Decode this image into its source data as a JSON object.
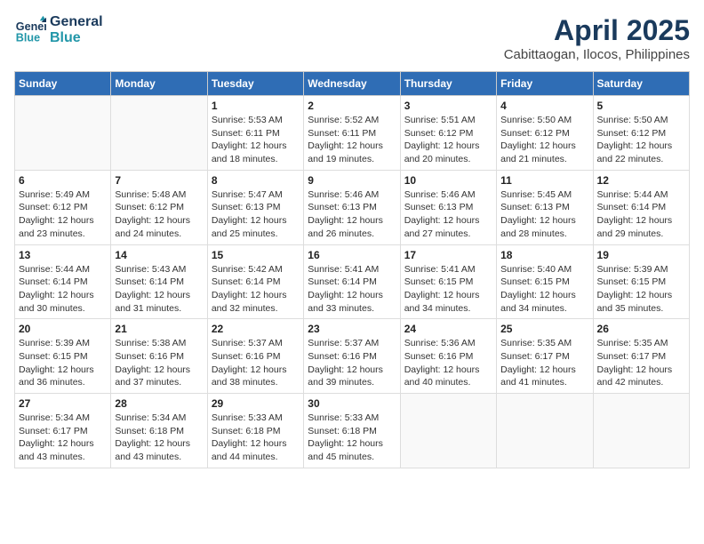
{
  "header": {
    "logo_line1": "General",
    "logo_line2": "Blue",
    "title": "April 2025",
    "subtitle": "Cabittaogan, Ilocos, Philippines"
  },
  "calendar": {
    "days_of_week": [
      "Sunday",
      "Monday",
      "Tuesday",
      "Wednesday",
      "Thursday",
      "Friday",
      "Saturday"
    ],
    "weeks": [
      [
        {
          "day": "",
          "info": ""
        },
        {
          "day": "",
          "info": ""
        },
        {
          "day": "1",
          "info": "Sunrise: 5:53 AM\nSunset: 6:11 PM\nDaylight: 12 hours and 18 minutes."
        },
        {
          "day": "2",
          "info": "Sunrise: 5:52 AM\nSunset: 6:11 PM\nDaylight: 12 hours and 19 minutes."
        },
        {
          "day": "3",
          "info": "Sunrise: 5:51 AM\nSunset: 6:12 PM\nDaylight: 12 hours and 20 minutes."
        },
        {
          "day": "4",
          "info": "Sunrise: 5:50 AM\nSunset: 6:12 PM\nDaylight: 12 hours and 21 minutes."
        },
        {
          "day": "5",
          "info": "Sunrise: 5:50 AM\nSunset: 6:12 PM\nDaylight: 12 hours and 22 minutes."
        }
      ],
      [
        {
          "day": "6",
          "info": "Sunrise: 5:49 AM\nSunset: 6:12 PM\nDaylight: 12 hours and 23 minutes."
        },
        {
          "day": "7",
          "info": "Sunrise: 5:48 AM\nSunset: 6:12 PM\nDaylight: 12 hours and 24 minutes."
        },
        {
          "day": "8",
          "info": "Sunrise: 5:47 AM\nSunset: 6:13 PM\nDaylight: 12 hours and 25 minutes."
        },
        {
          "day": "9",
          "info": "Sunrise: 5:46 AM\nSunset: 6:13 PM\nDaylight: 12 hours and 26 minutes."
        },
        {
          "day": "10",
          "info": "Sunrise: 5:46 AM\nSunset: 6:13 PM\nDaylight: 12 hours and 27 minutes."
        },
        {
          "day": "11",
          "info": "Sunrise: 5:45 AM\nSunset: 6:13 PM\nDaylight: 12 hours and 28 minutes."
        },
        {
          "day": "12",
          "info": "Sunrise: 5:44 AM\nSunset: 6:14 PM\nDaylight: 12 hours and 29 minutes."
        }
      ],
      [
        {
          "day": "13",
          "info": "Sunrise: 5:44 AM\nSunset: 6:14 PM\nDaylight: 12 hours and 30 minutes."
        },
        {
          "day": "14",
          "info": "Sunrise: 5:43 AM\nSunset: 6:14 PM\nDaylight: 12 hours and 31 minutes."
        },
        {
          "day": "15",
          "info": "Sunrise: 5:42 AM\nSunset: 6:14 PM\nDaylight: 12 hours and 32 minutes."
        },
        {
          "day": "16",
          "info": "Sunrise: 5:41 AM\nSunset: 6:14 PM\nDaylight: 12 hours and 33 minutes."
        },
        {
          "day": "17",
          "info": "Sunrise: 5:41 AM\nSunset: 6:15 PM\nDaylight: 12 hours and 34 minutes."
        },
        {
          "day": "18",
          "info": "Sunrise: 5:40 AM\nSunset: 6:15 PM\nDaylight: 12 hours and 34 minutes."
        },
        {
          "day": "19",
          "info": "Sunrise: 5:39 AM\nSunset: 6:15 PM\nDaylight: 12 hours and 35 minutes."
        }
      ],
      [
        {
          "day": "20",
          "info": "Sunrise: 5:39 AM\nSunset: 6:15 PM\nDaylight: 12 hours and 36 minutes."
        },
        {
          "day": "21",
          "info": "Sunrise: 5:38 AM\nSunset: 6:16 PM\nDaylight: 12 hours and 37 minutes."
        },
        {
          "day": "22",
          "info": "Sunrise: 5:37 AM\nSunset: 6:16 PM\nDaylight: 12 hours and 38 minutes."
        },
        {
          "day": "23",
          "info": "Sunrise: 5:37 AM\nSunset: 6:16 PM\nDaylight: 12 hours and 39 minutes."
        },
        {
          "day": "24",
          "info": "Sunrise: 5:36 AM\nSunset: 6:16 PM\nDaylight: 12 hours and 40 minutes."
        },
        {
          "day": "25",
          "info": "Sunrise: 5:35 AM\nSunset: 6:17 PM\nDaylight: 12 hours and 41 minutes."
        },
        {
          "day": "26",
          "info": "Sunrise: 5:35 AM\nSunset: 6:17 PM\nDaylight: 12 hours and 42 minutes."
        }
      ],
      [
        {
          "day": "27",
          "info": "Sunrise: 5:34 AM\nSunset: 6:17 PM\nDaylight: 12 hours and 43 minutes."
        },
        {
          "day": "28",
          "info": "Sunrise: 5:34 AM\nSunset: 6:18 PM\nDaylight: 12 hours and 43 minutes."
        },
        {
          "day": "29",
          "info": "Sunrise: 5:33 AM\nSunset: 6:18 PM\nDaylight: 12 hours and 44 minutes."
        },
        {
          "day": "30",
          "info": "Sunrise: 5:33 AM\nSunset: 6:18 PM\nDaylight: 12 hours and 45 minutes."
        },
        {
          "day": "",
          "info": ""
        },
        {
          "day": "",
          "info": ""
        },
        {
          "day": "",
          "info": ""
        }
      ]
    ]
  }
}
